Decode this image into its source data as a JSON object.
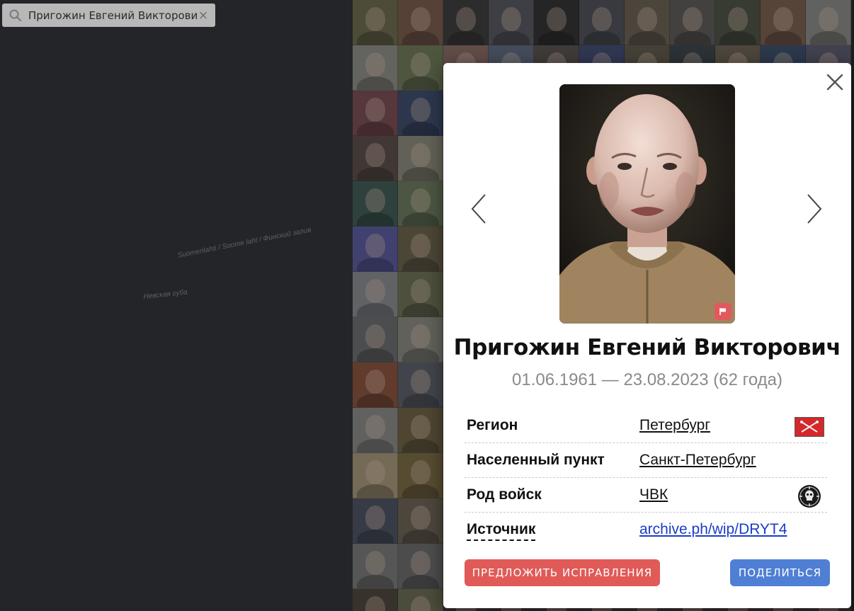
{
  "search": {
    "value": "Пригожин Евгений Викторович",
    "icon": "search-icon",
    "clear_glyph": "×"
  },
  "map": {
    "label_gulf": "Suomenlahti / Soome laht / Финский залив",
    "label_bay": "Невская губа"
  },
  "grid": {
    "tile_colors": [
      [
        "#6b6a4a",
        "#7a5a48",
        "#3a3a3a",
        "#55565c",
        "#2f2f2f",
        "#4e4f55",
        "#6a6050",
        "#5d5a55",
        "#4a5040",
        "#7a5e4c",
        "#8a8a86"
      ],
      [
        "#8e8e86",
        "#6d7a55",
        "#8a6a62",
        "#5e6a80",
        "#56504a",
        "#3f4a70",
        "#605a48",
        "#3a4248",
        "#6a6250",
        "#3a4e6a",
        "#5a5a6e"
      ],
      [
        "#7a4a50",
        "#3a4a6a",
        "#3a3a3c",
        "#3a3a3c",
        "#3a3a3c",
        "#3a3a3c",
        "#3a3a3c",
        "#3a3a3c",
        "#3a3a3c",
        "#3a3a3c",
        "#3a3a3c"
      ],
      [
        "#5a4c46",
        "#8a8a7a",
        "#3a3a3c",
        "#3a3a3c",
        "#3a3a3c",
        "#3a3a3c",
        "#3a3a3c",
        "#3a3a3c",
        "#3a3a3c",
        "#3a3a3c",
        "#3a3a3c"
      ],
      [
        "#3d5a52",
        "#6a7a5a",
        "#3a3a3c",
        "#3a3a3c",
        "#3a3a3c",
        "#3a3a3c",
        "#3a3a3c",
        "#3a3a3c",
        "#3a3a3c",
        "#3a3a3c",
        "#3a3a3c"
      ],
      [
        "#5a5aa0",
        "#6a6248",
        "#3a3a3c",
        "#3a3a3c",
        "#3a3a3c",
        "#3a3a3c",
        "#3a3a3c",
        "#3a3a3c",
        "#3a3a3c",
        "#3a3a3c",
        "#3a3a3c"
      ],
      [
        "#8a8c90",
        "#6a7050",
        "#3a3a3c",
        "#3a3a3c",
        "#3a3a3c",
        "#3a3a3c",
        "#3a3a3c",
        "#3a3a3c",
        "#3a3a3c",
        "#3a3a3c",
        "#3a3a3c"
      ],
      [
        "#6a6c6e",
        "#8a8a80",
        "#3a3a3c",
        "#3a3a3c",
        "#3a3a3c",
        "#3a3a3c",
        "#3a3a3c",
        "#3a3a3c",
        "#3a3a3c",
        "#3a3a3c",
        "#3a3a3c"
      ],
      [
        "#8a5038",
        "#5a6068",
        "#3a3a3c",
        "#3a3a3c",
        "#3a3a3c",
        "#3a3a3c",
        "#3a3a3c",
        "#3a3a3c",
        "#3a3a3c",
        "#3a3a3c",
        "#3a3a3c"
      ],
      [
        "#8a8c88",
        "#6e6240",
        "#3a3a3c",
        "#3a3a3c",
        "#3a3a3c",
        "#3a3a3c",
        "#3a3a3c",
        "#3a3a3c",
        "#3a3a3c",
        "#3a3a3c",
        "#3a3a3c"
      ],
      [
        "#a89878",
        "#7a6a40",
        "#3a3a3c",
        "#3a3a3c",
        "#3a3a3c",
        "#3a3a3c",
        "#3a3a3c",
        "#3a3a3c",
        "#3a3a3c",
        "#3a3a3c",
        "#3a3a3c"
      ],
      [
        "#4a5060",
        "#6a6250",
        "#3a3a3c",
        "#3a3a3c",
        "#3a3a3c",
        "#3a3a3c",
        "#3a3a3c",
        "#3a3a3c",
        "#3a3a3c",
        "#3a3a3c",
        "#3a3a3c"
      ],
      [
        "#7a7a78",
        "#6a6a6a",
        "#3a3a3c",
        "#3a3a3c",
        "#3a3a3c",
        "#3a3a3c",
        "#3a3a3c",
        "#3a3a3c",
        "#3a3a3c",
        "#3a3a3c",
        "#3a3a3c"
      ],
      [
        "#4a4238",
        "#6a6a50",
        "#3a3a3c",
        "#3a3a3c",
        "#3a3a3c",
        "#3a3a3c",
        "#3a3a3c",
        "#3a3a3c",
        "#3a3a3c",
        "#3a3a3c",
        "#3a3a3c"
      ]
    ]
  },
  "modal": {
    "close_icon": "close-icon",
    "prev_icon": "chevron-left-icon",
    "next_icon": "chevron-right-icon",
    "report_icon": "flag-icon",
    "name": "Пригожин Евгений Викторович",
    "dates": "01.06.1961 — 23.08.2023 (62 года)",
    "rows": [
      {
        "key": "Регион",
        "value": "Петербург",
        "badge": "region-flag-icon"
      },
      {
        "key": "Населенный пункт",
        "value": "Санкт-Петербург"
      },
      {
        "key": "Род войск",
        "value": "ЧВК",
        "badge": "pmc-emblem-icon"
      },
      {
        "key": "Источник",
        "value": "archive.ph/wip/DRYT4"
      }
    ],
    "suggest_label": "ПРЕДЛОЖИТЬ ИСПРАВЛЕНИЯ",
    "share_label": "ПОДЕЛИТЬСЯ",
    "colors": {
      "suggest": "#e05a57",
      "share": "#4f7fd4",
      "link": "#1a3cc8",
      "flag": "#e2585c"
    }
  }
}
